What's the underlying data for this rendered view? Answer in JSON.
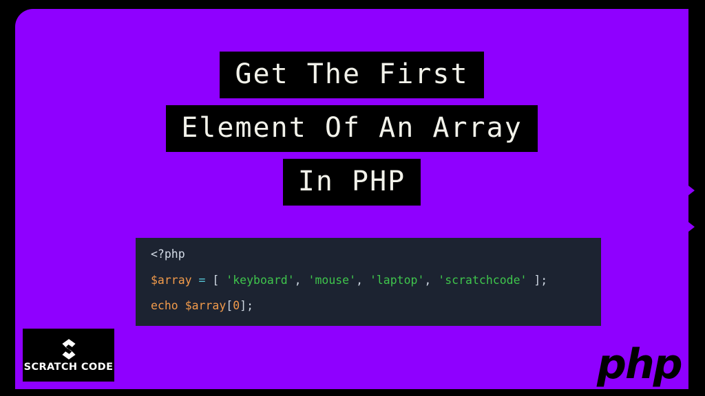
{
  "slide": {
    "background_color": "#8f00ff",
    "frame_color": "#000000"
  },
  "title": {
    "lines": [
      "Get The First",
      "Element Of An Array",
      "In PHP"
    ],
    "text_color": "#f2f2ea",
    "highlight_color": "#000000"
  },
  "code_block": {
    "language": "php",
    "background_color": "#1c2331",
    "lines": [
      {
        "tokens": [
          {
            "text": "<?php",
            "type": "tag"
          }
        ]
      },
      {
        "tokens": [
          {
            "text": "$array",
            "type": "var"
          },
          {
            "text": " ",
            "type": "punc"
          },
          {
            "text": "=",
            "type": "op"
          },
          {
            "text": " ",
            "type": "punc"
          },
          {
            "text": "[",
            "type": "punc"
          },
          {
            "text": " ",
            "type": "punc"
          },
          {
            "text": "'keyboard'",
            "type": "str"
          },
          {
            "text": ",",
            "type": "punc"
          },
          {
            "text": " ",
            "type": "punc"
          },
          {
            "text": "'mouse'",
            "type": "str"
          },
          {
            "text": ",",
            "type": "punc"
          },
          {
            "text": " ",
            "type": "punc"
          },
          {
            "text": "'laptop'",
            "type": "str"
          },
          {
            "text": ",",
            "type": "punc"
          },
          {
            "text": " ",
            "type": "punc"
          },
          {
            "text": "'scratchcode'",
            "type": "str"
          },
          {
            "text": " ",
            "type": "punc"
          },
          {
            "text": "];",
            "type": "punc"
          }
        ]
      },
      {
        "tokens": [
          {
            "text": "echo",
            "type": "kw"
          },
          {
            "text": " ",
            "type": "punc"
          },
          {
            "text": "$array",
            "type": "var"
          },
          {
            "text": "[",
            "type": "punc"
          },
          {
            "text": "0",
            "type": "num"
          },
          {
            "text": "];",
            "type": "punc"
          }
        ]
      }
    ],
    "token_colors": {
      "tag": "#d5dde8",
      "punc": "#cfd8e3",
      "var": "#f29b4b",
      "op": "#56c8d8",
      "str": "#3fc54c",
      "kw": "#f29b4b",
      "num": "#f29b4b"
    }
  },
  "brand_logo": {
    "wordmark": "SCRATCH CODE",
    "icon": "scratchcode-s-mark-icon",
    "background_color": "#000000",
    "text_color": "#ffffff"
  },
  "php_logo": {
    "wordmark": "php",
    "color": "#000000"
  }
}
